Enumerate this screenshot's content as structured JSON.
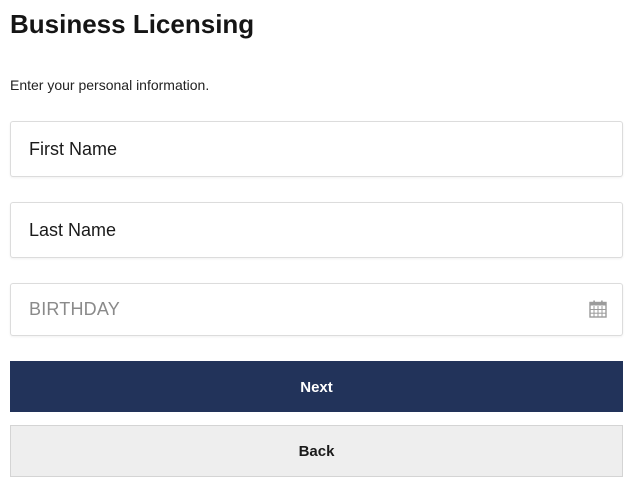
{
  "header": {
    "title": "Business Licensing",
    "subtitle": "Enter your personal information."
  },
  "form": {
    "first_name": {
      "placeholder": "First Name",
      "value": ""
    },
    "last_name": {
      "placeholder": "Last Name",
      "value": ""
    },
    "birthday": {
      "placeholder": "BIRTHDAY",
      "value": "",
      "icon": "calendar-icon"
    }
  },
  "actions": {
    "next_label": "Next",
    "back_label": "Back"
  },
  "colors": {
    "primary": "#22335a",
    "secondary_bg": "#eeeeee",
    "placeholder_muted": "#8a8a8a"
  }
}
